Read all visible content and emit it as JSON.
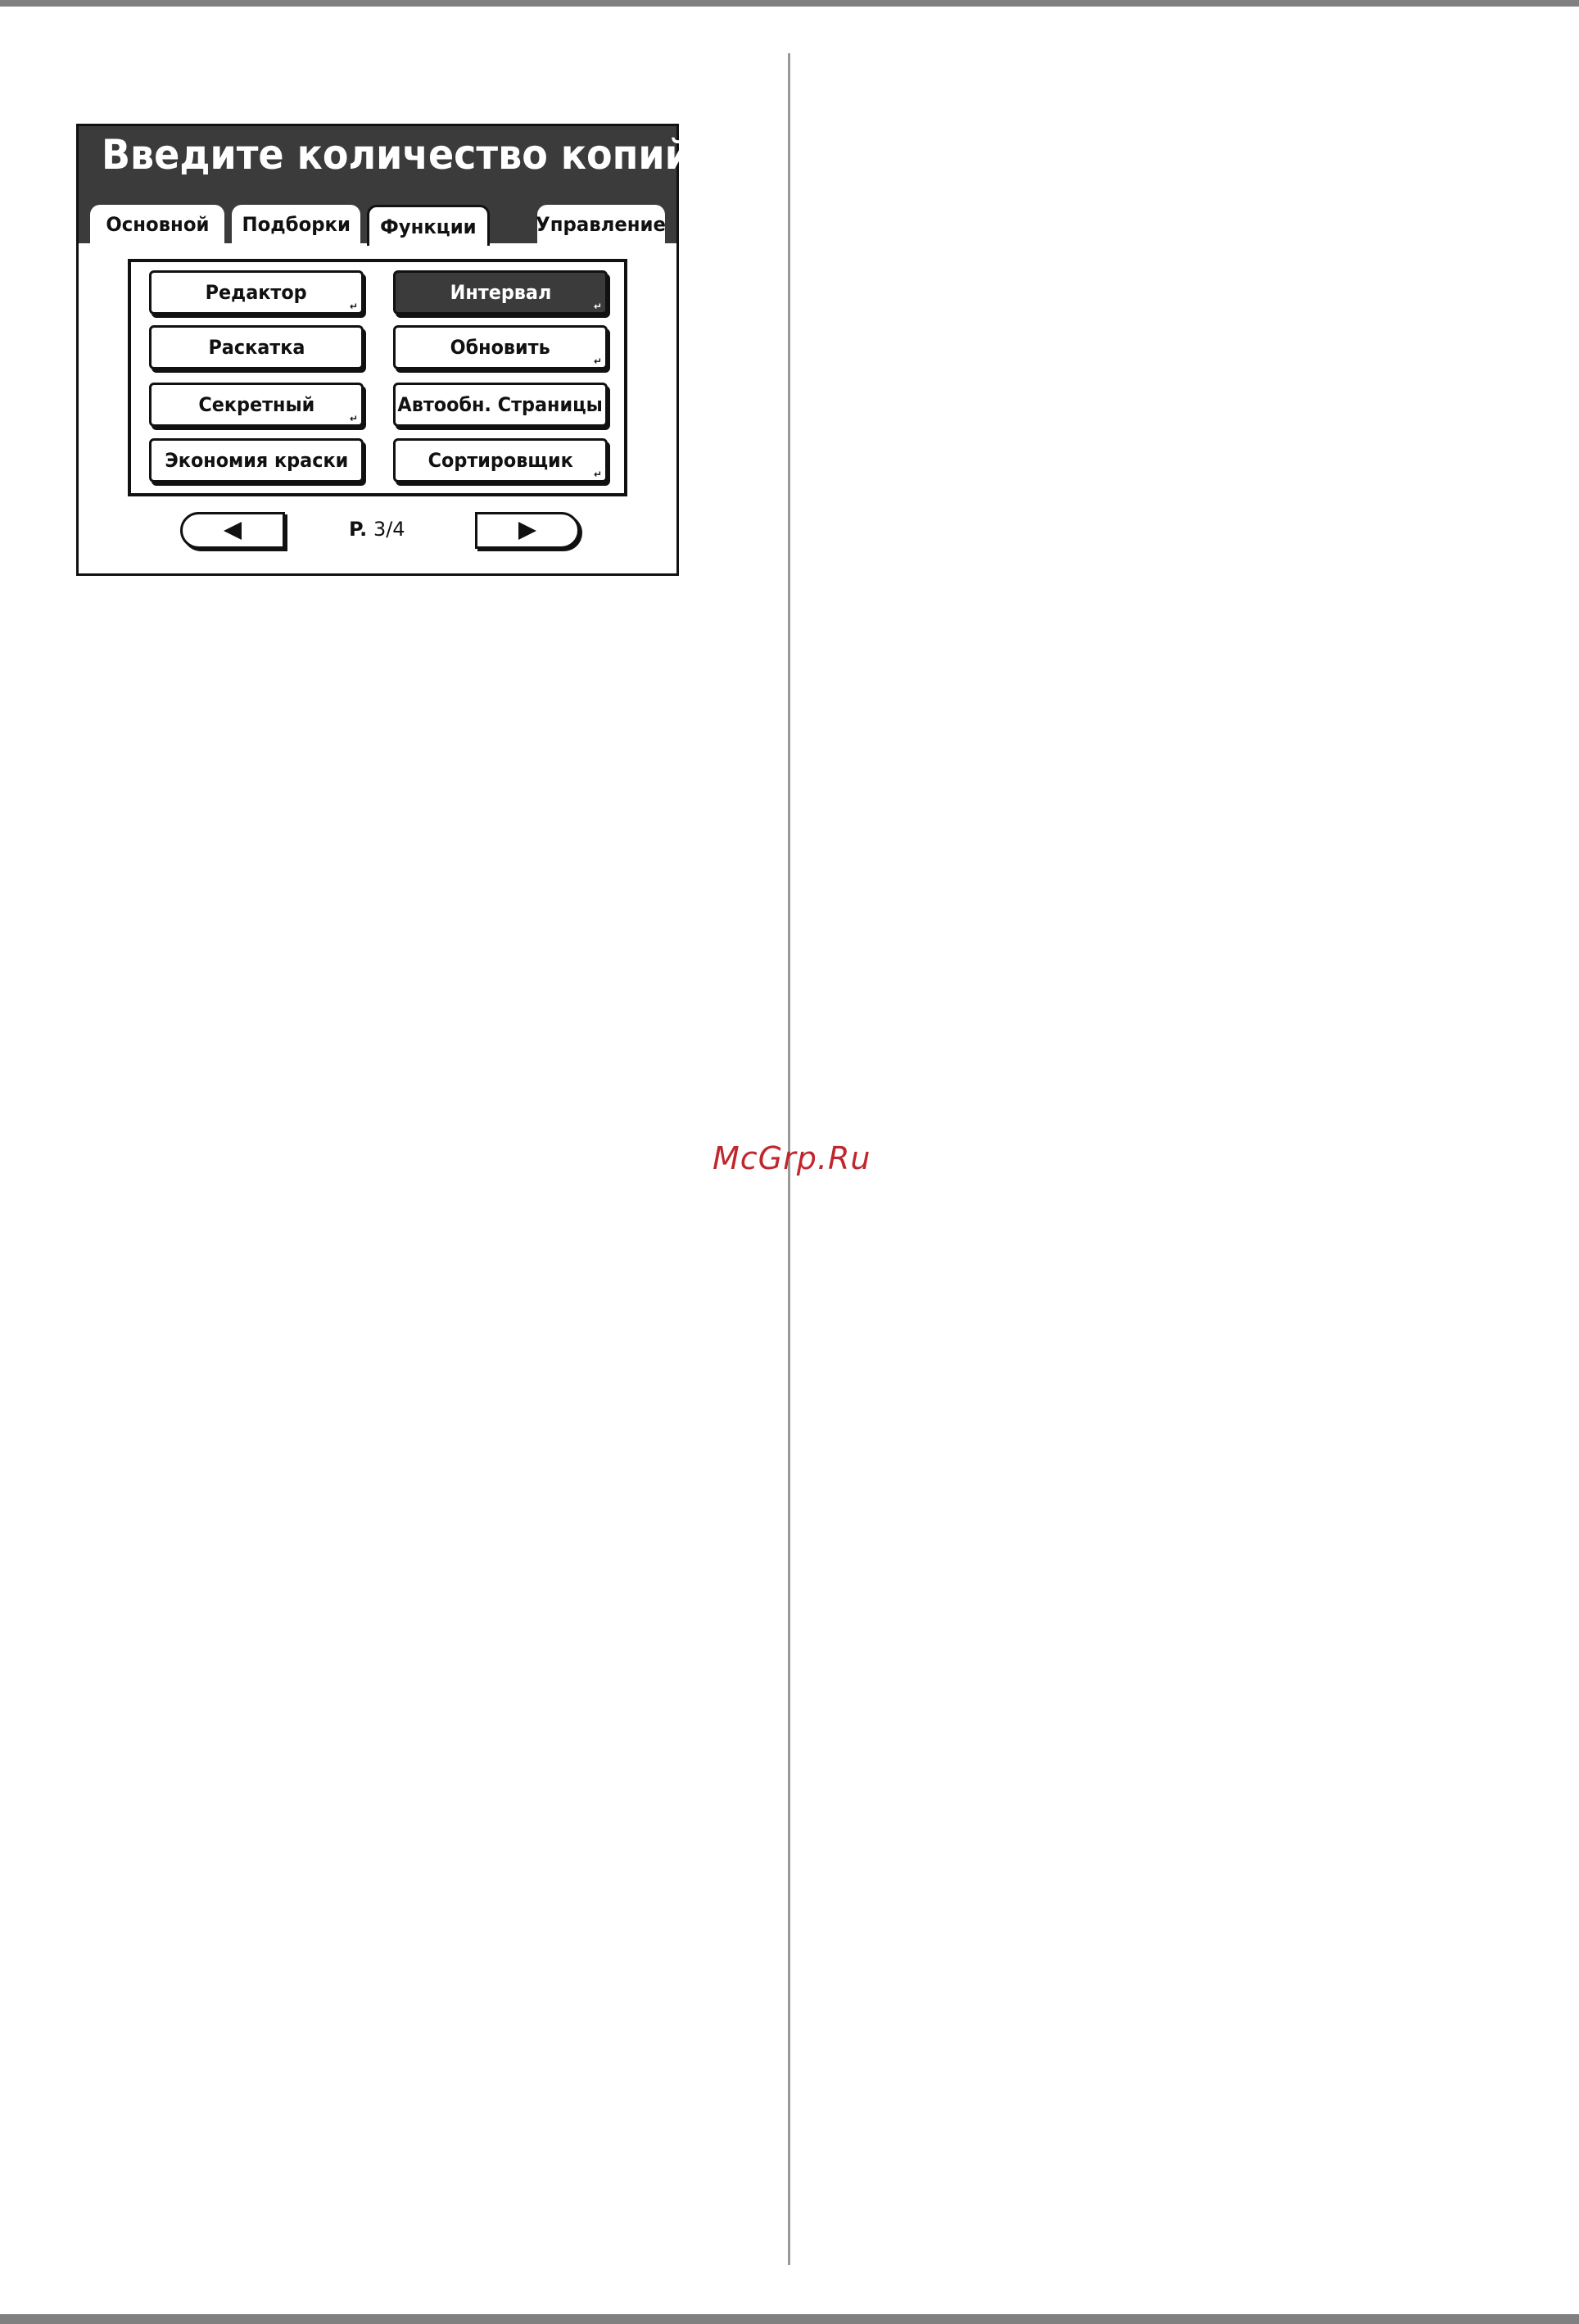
{
  "panel": {
    "title": "Введите количество копий",
    "tabs": [
      {
        "label": "Основной",
        "active": false
      },
      {
        "label": "Подборки",
        "active": false
      },
      {
        "label": "Функции",
        "active": true
      },
      {
        "label": "Управление",
        "active": false
      }
    ],
    "buttons": [
      {
        "label": "Редактор",
        "selected": false,
        "submenu": true
      },
      {
        "label": "Интервал",
        "selected": true,
        "submenu": true
      },
      {
        "label": "Раскатка",
        "selected": false,
        "submenu": false
      },
      {
        "label": "Обновить",
        "selected": false,
        "submenu": true
      },
      {
        "label": "Секретный",
        "selected": false,
        "submenu": true
      },
      {
        "label": "Автообн. Страницы",
        "selected": false,
        "submenu": false
      },
      {
        "label": "Экономия краски",
        "selected": false,
        "submenu": false
      },
      {
        "label": "Сортировщик",
        "selected": false,
        "submenu": true
      }
    ],
    "pager": {
      "prefix": "P.",
      "current": "3/4",
      "prev_icon": "triangle-left-icon",
      "next_icon": "triangle-right-icon"
    },
    "submenu_glyph": "↵"
  },
  "watermark": "McGrp.Ru",
  "colors": {
    "header_bg": "#3b3b3b",
    "selected_bg": "#3b3b3b",
    "border": "#111111",
    "watermark": "#c0272d",
    "page_bars": "#808080"
  }
}
